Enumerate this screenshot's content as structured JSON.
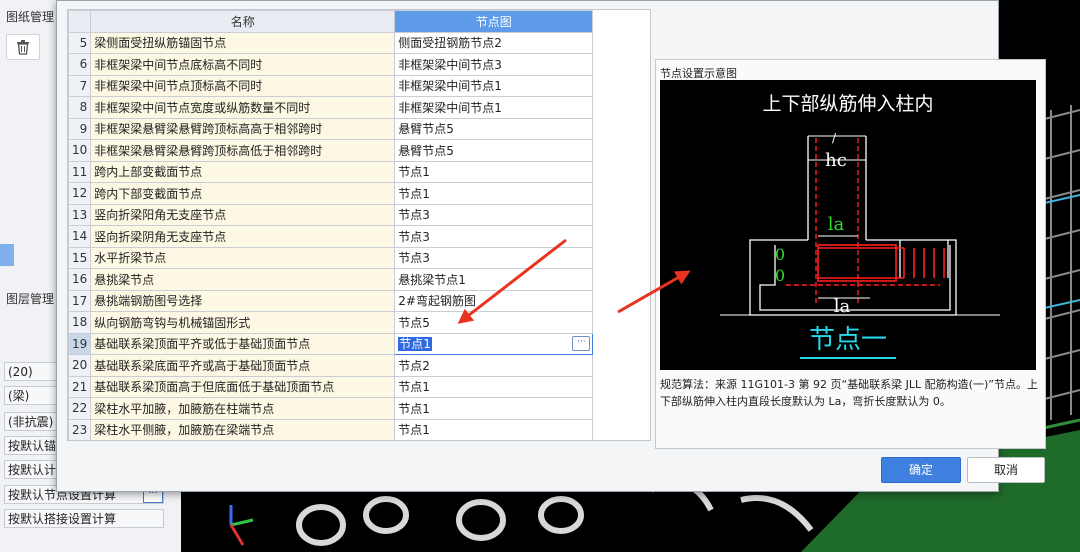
{
  "left_panel": {
    "drawing_title": "图纸管理",
    "layer_title": "图层管理",
    "rows": [
      "(20)",
      "(梁)",
      "(非抗震)",
      "按默认锚",
      "按默认计",
      "按默认节点设置计算",
      "按默认搭接设置计算"
    ],
    "rows_dots_label": "···"
  },
  "table": {
    "headers": {
      "name": "名称",
      "node": "节点图"
    },
    "rows": [
      {
        "idx": "5",
        "name": "梁侧面受扭纵筋锚固节点",
        "value": "侧面受扭钢筋节点2"
      },
      {
        "idx": "6",
        "name": "非框架梁中间节点底标高不同时",
        "value": "非框架梁中间节点3"
      },
      {
        "idx": "7",
        "name": "非框架梁中间节点顶标高不同时",
        "value": "非框架梁中间节点1"
      },
      {
        "idx": "8",
        "name": "非框架梁中间节点宽度或纵筋数量不同时",
        "value": "非框架梁中间节点1"
      },
      {
        "idx": "9",
        "name": "非框架梁悬臂梁悬臂跨顶标高高于相邻跨时",
        "value": "悬臂节点5"
      },
      {
        "idx": "10",
        "name": "非框架梁悬臂梁悬臂跨顶标高低于相邻跨时",
        "value": "悬臂节点5"
      },
      {
        "idx": "11",
        "name": "跨内上部变截面节点",
        "value": "节点1"
      },
      {
        "idx": "12",
        "name": "跨内下部变截面节点",
        "value": "节点1"
      },
      {
        "idx": "13",
        "name": "竖向折梁阳角无支座节点",
        "value": "节点3"
      },
      {
        "idx": "14",
        "name": "竖向折梁阴角无支座节点",
        "value": "节点3"
      },
      {
        "idx": "15",
        "name": "水平折梁节点",
        "value": "节点3"
      },
      {
        "idx": "16",
        "name": "悬挑梁节点",
        "value": "悬挑梁节点1"
      },
      {
        "idx": "17",
        "name": "悬挑端钢筋图号选择",
        "value": "2#弯起钢筋图"
      },
      {
        "idx": "18",
        "name": "纵向钢筋弯钩与机械锚固形式",
        "value": "节点5"
      },
      {
        "idx": "19",
        "name": "基础联系梁顶面平齐或低于基础顶面节点",
        "value": "节点1"
      },
      {
        "idx": "20",
        "name": "基础联系梁底面平齐或高于基础顶面节点",
        "value": "节点2"
      },
      {
        "idx": "21",
        "name": "基础联系梁顶面高于但底面低于基础顶面节点",
        "value": "节点1"
      },
      {
        "idx": "22",
        "name": "梁柱水平加腋，加腋筋在柱端节点",
        "value": "节点1"
      },
      {
        "idx": "23",
        "name": "梁柱水平侧腋，加腋筋在梁端节点",
        "value": "节点1"
      },
      {
        "idx": "24",
        "name": "梁柱水平加腋附加箍筋节点",
        "value": "节点1"
      }
    ],
    "edit_button_label": "···"
  },
  "preview": {
    "title": "节点设置示意图",
    "diagram_title": "上下部纵筋伸入柱内",
    "label_hc": "hc",
    "label_la_top": "la",
    "label_la_bottom": "la",
    "label_zero_1": "0",
    "label_zero_2": "0",
    "node_caption": "节点一",
    "description": "规范算法：来源 11G101-3 第 92 页“基础联系梁 JLL 配筋构造(一)”节点。上下部纵筋伸入柱内直段长度默认为 La，弯折长度默认为 0。"
  },
  "buttons": {
    "ok": "确定",
    "cancel": "取消"
  },
  "colors": {
    "accent": "#3f7fe0",
    "header_selected": "#5d9be8",
    "name_cell": "#fdf8e3",
    "annotation_arrow": "#e8331f"
  }
}
